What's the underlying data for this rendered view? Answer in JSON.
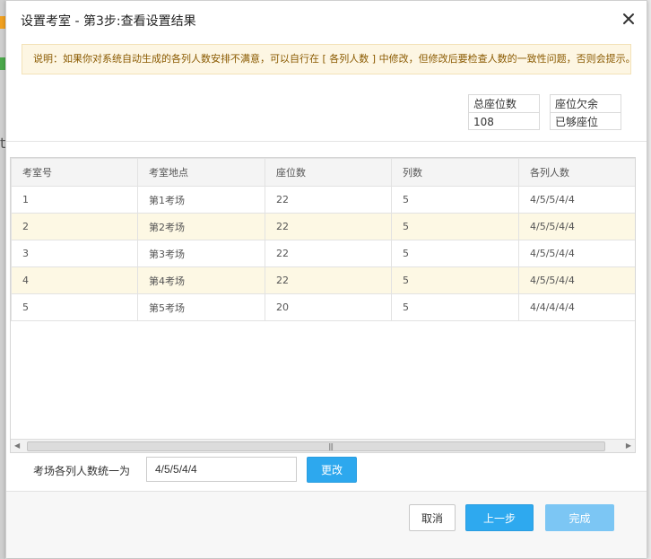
{
  "dialog": {
    "title": "设置考室 - 第3步:查看设置结果",
    "notice": "说明：如果你对系统自动生成的各列人数安排不满意，可以自行在 [ 各列人数 ] 中修改，但修改后要检查人数的一致性问题，否则会提示。"
  },
  "summary": {
    "total_seats_label": "总座位数",
    "total_seats_value": "108",
    "shortage_label": "座位欠余",
    "shortage_value": "已够座位"
  },
  "table": {
    "columns": [
      "考室号",
      "考室地点",
      "座位数",
      "列数",
      "各列人数"
    ],
    "rows": [
      [
        "1",
        "第1考场",
        "22",
        "5",
        "4/5/5/4/4"
      ],
      [
        "2",
        "第2考场",
        "22",
        "5",
        "4/5/5/4/4"
      ],
      [
        "3",
        "第3考场",
        "22",
        "5",
        "4/5/5/4/4"
      ],
      [
        "4",
        "第4考场",
        "22",
        "5",
        "4/5/5/4/4"
      ],
      [
        "5",
        "第5考场",
        "20",
        "5",
        "4/4/4/4/4"
      ]
    ]
  },
  "unify": {
    "label": "考场各列人数统一为",
    "value": "4/5/5/4/4",
    "button": "更改"
  },
  "footer": {
    "cancel": "取消",
    "prev": "上一步",
    "done": "完成"
  },
  "colors": {
    "primary": "#2ea9ef",
    "primary_disabled": "#7cc6f4",
    "notice_bg": "#fdf6e3",
    "notice_text": "#8a5a00",
    "row_alt": "#fdf8e4"
  }
}
